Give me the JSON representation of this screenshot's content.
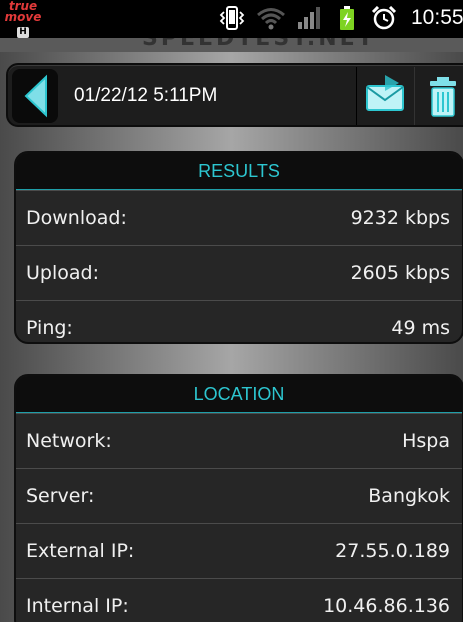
{
  "status_bar": {
    "carrier_line1": "true",
    "carrier_line2": "move",
    "carrier_badge": "H",
    "time": "10:55",
    "icons": [
      "vibrate-icon",
      "wifi-icon",
      "signal-icon",
      "battery-charging-icon",
      "alarm-icon"
    ]
  },
  "app": {
    "logo_text": "SPEEDTEST.NET"
  },
  "header": {
    "date": "01/22/12 5:11PM",
    "back_icon": "back-arrow-icon",
    "mail_icon": "mail-icon",
    "trash_icon": "trash-icon"
  },
  "results": {
    "title": "RESULTS",
    "rows": [
      {
        "label": "Download:",
        "value": "9232 kbps"
      },
      {
        "label": "Upload:",
        "value": "2605 kbps"
      },
      {
        "label": "Ping:",
        "value": "49 ms"
      }
    ]
  },
  "location": {
    "title": "LOCATION",
    "rows": [
      {
        "label": "Network:",
        "value": "Hspa"
      },
      {
        "label": "Server:",
        "value": "Bangkok"
      },
      {
        "label": "External IP:",
        "value": "27.55.0.189"
      },
      {
        "label": "Internal IP:",
        "value": "10.46.86.136"
      }
    ]
  },
  "colors": {
    "accent": "#2dc6d0",
    "panel_bg": "#262626",
    "header_bg": "#0d0d0d"
  }
}
